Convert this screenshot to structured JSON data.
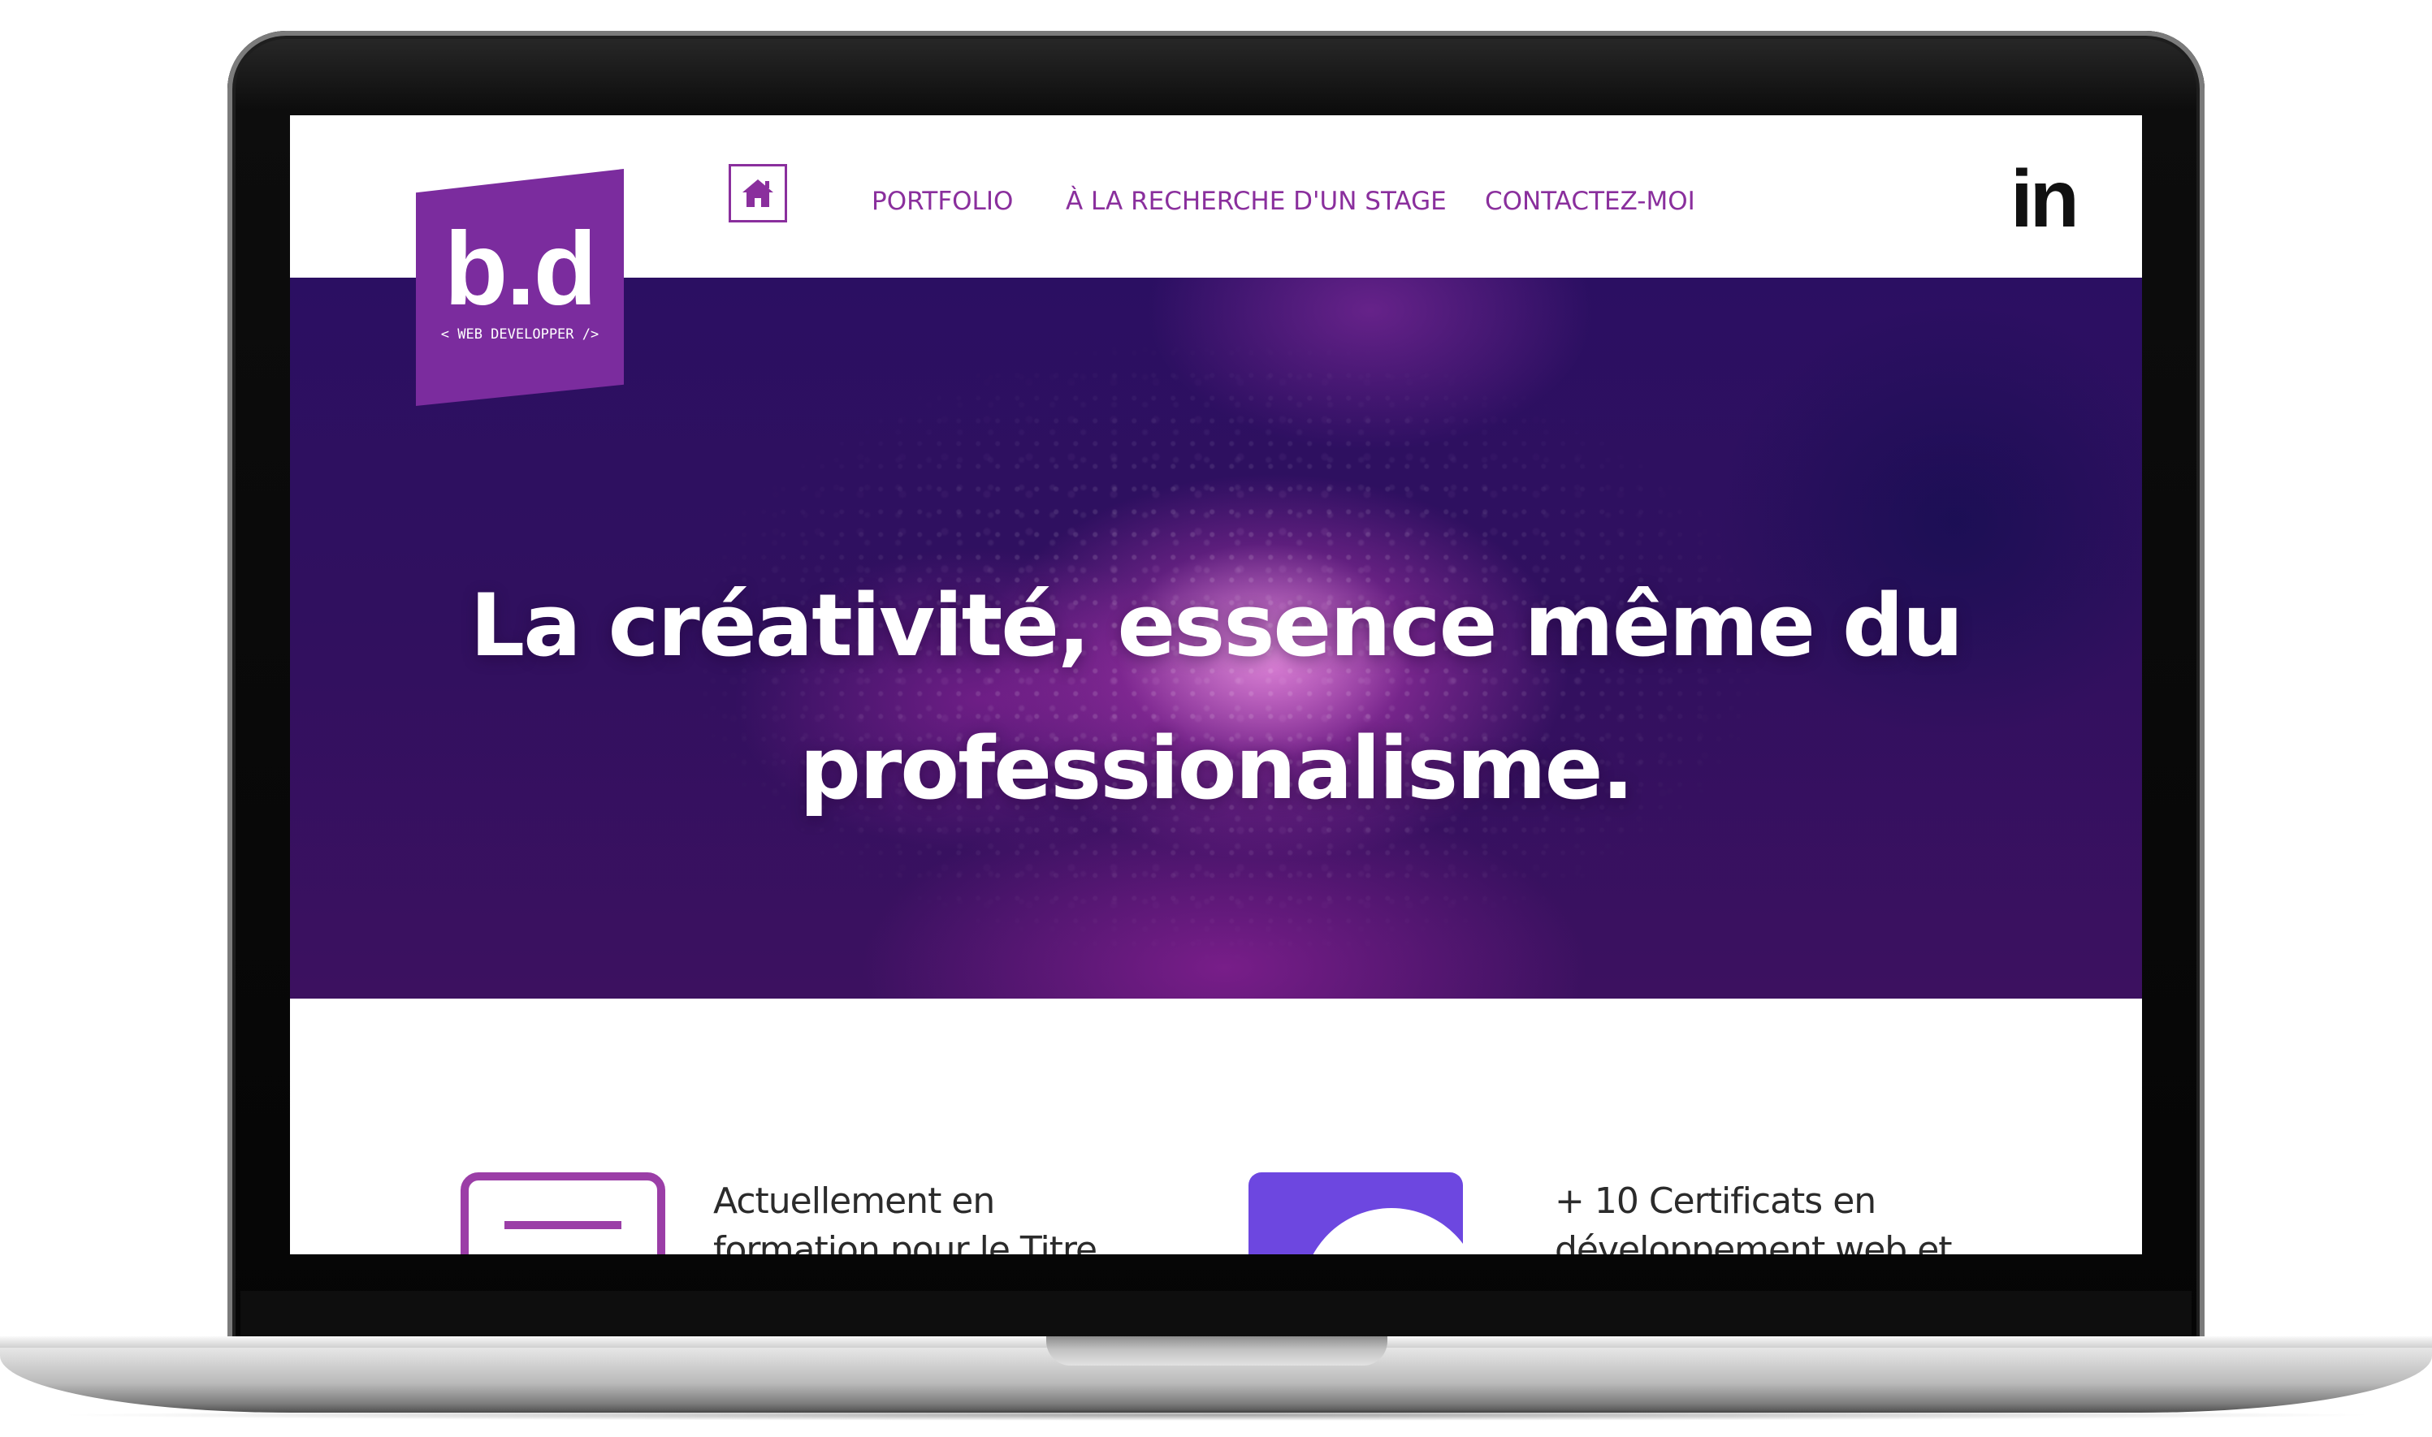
{
  "brand": {
    "logo_text": "b.d",
    "logo_tagline": "< WEB DEVELOPPER />",
    "color": "#7b2c9e"
  },
  "nav": {
    "home_icon": "home-icon",
    "items": [
      {
        "label": "PORTFOLIO"
      },
      {
        "label": "À LA RECHERCHE D'UN STAGE"
      },
      {
        "label": "CONTACTEZ-MOI"
      }
    ],
    "link_color": "#8a2f9d",
    "social": {
      "label": "in",
      "icon": "linkedin-icon"
    }
  },
  "hero": {
    "title_line1": "La créativité, essence même du",
    "title_line2": "professionalisme."
  },
  "features": [
    {
      "icon": "monitor-icon",
      "text_line1": "Actuellement en",
      "text_line2": "formation pour le Titre",
      "color": "#9b3ea7"
    },
    {
      "icon": "certificate-icon",
      "text_line1": "+ 10 Certificats en",
      "text_line2": "développement web et",
      "color": "#6d47e0"
    }
  ]
}
